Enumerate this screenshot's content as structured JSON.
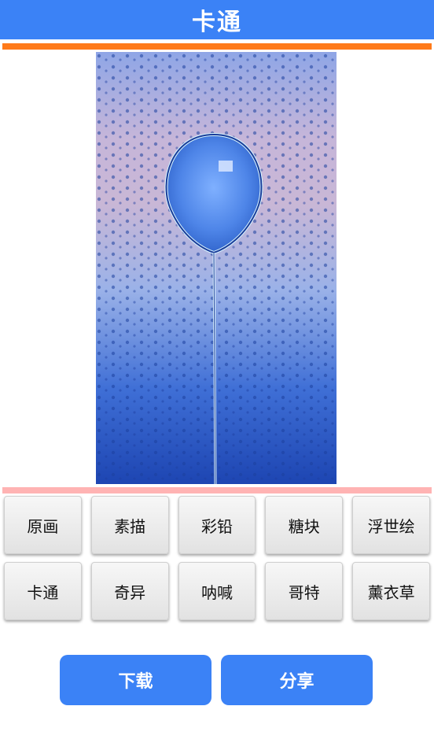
{
  "header": {
    "title": "卡通"
  },
  "filters": {
    "row1": [
      "原画",
      "素描",
      "彩铅",
      "糖块",
      "浮世绘"
    ],
    "row2": [
      "卡通",
      "奇异",
      "呐喊",
      "哥特",
      "薰衣草"
    ]
  },
  "actions": {
    "download": "下载",
    "share": "分享"
  }
}
